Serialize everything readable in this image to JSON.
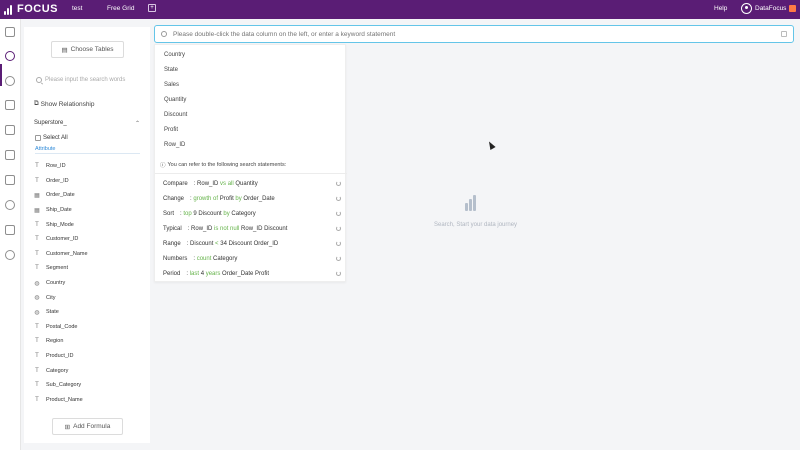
{
  "topbar": {
    "logo_text": "FOCUS",
    "tabs": [
      {
        "label": "test"
      },
      {
        "label": "Free Grid"
      }
    ],
    "help_label": "Help",
    "user_name": "DataFocus",
    "bg_color": "#5a1d75"
  },
  "left_nav": {
    "items": [
      "home-icon",
      "search-icon",
      "help-icon",
      "monitor-icon",
      "table-icon",
      "inbox-icon",
      "clipboard-icon",
      "user-icon",
      "activity-icon",
      "settings-icon"
    ],
    "active": "search-icon"
  },
  "panel": {
    "choose_tables_label": "Choose Tables",
    "search_placeholder": "Please input the search words",
    "show_relationship_label": "Show Relationship",
    "table_name": "Superstore_",
    "select_all_label": "Select All",
    "attribute_label": "Attribute",
    "fields": [
      {
        "name": "Row_ID",
        "type": "text"
      },
      {
        "name": "Order_ID",
        "type": "text"
      },
      {
        "name": "Order_Date",
        "type": "date"
      },
      {
        "name": "Ship_Date",
        "type": "date"
      },
      {
        "name": "Ship_Mode",
        "type": "text"
      },
      {
        "name": "Customer_ID",
        "type": "text"
      },
      {
        "name": "Customer_Name",
        "type": "text"
      },
      {
        "name": "Segment",
        "type": "text"
      },
      {
        "name": "Country",
        "type": "geo"
      },
      {
        "name": "City",
        "type": "geo"
      },
      {
        "name": "State",
        "type": "geo"
      },
      {
        "name": "Postal_Code",
        "type": "text"
      },
      {
        "name": "Region",
        "type": "text"
      },
      {
        "name": "Product_ID",
        "type": "text"
      },
      {
        "name": "Category",
        "type": "text"
      },
      {
        "name": "Sub_Category",
        "type": "text"
      },
      {
        "name": "Product_Name",
        "type": "text"
      }
    ],
    "add_formula_label": "Add Formula"
  },
  "search": {
    "placeholder": "Please double-click the data column on the left, or enter a keyword statement"
  },
  "dropdown": {
    "suggestions": [
      "Country",
      "State",
      "Sales",
      "Quantity",
      "Discount",
      "Profit",
      "Row_ID"
    ],
    "hint": "You can refer to the following search statements:",
    "statements": [
      {
        "kind": "Compare",
        "parts": [
          ": Row_ID ",
          "vs all",
          " Quantity"
        ]
      },
      {
        "kind": "Change",
        "parts": [
          ": ",
          "growth of",
          " Profit ",
          "by",
          " Order_Date"
        ]
      },
      {
        "kind": "Sort",
        "parts": [
          ": ",
          "top",
          " 9 Discount ",
          "by",
          " Category"
        ]
      },
      {
        "kind": "Typical",
        "parts": [
          ": Row_ID ",
          "is not null",
          " Row_ID Discount"
        ]
      },
      {
        "kind": "Range",
        "parts": [
          ": Discount ",
          "<",
          " 34 Discount Order_ID"
        ]
      },
      {
        "kind": "Numbers",
        "parts": [
          ": ",
          "count",
          " Category"
        ]
      },
      {
        "kind": "Period",
        "parts": [
          ": ",
          "last",
          " 4 ",
          "years",
          " Order_Date Profit"
        ]
      }
    ]
  },
  "empty_state": {
    "text": "Search, Start your data journey"
  },
  "colors": {
    "accent": "#5a1d75",
    "keyword": "#65b34a",
    "focus_border": "#64c5e8",
    "link": "#2f8ad8"
  }
}
